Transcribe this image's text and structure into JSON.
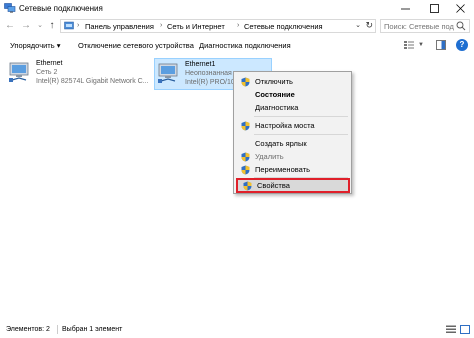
{
  "window": {
    "title": "Сетевые подключения",
    "minimize_icon": "minimize-icon",
    "maximize_icon": "maximize-icon",
    "close_icon": "close-icon"
  },
  "address": {
    "crumbs": [
      "Панель управления",
      "Сеть и Интернет",
      "Сетевые подключения"
    ],
    "search_placeholder": "Поиск: Сетевые подключения"
  },
  "toolbar": {
    "organize": "Упорядочить ▾",
    "disable": "Отключение сетевого устройства",
    "diagnose": "Диагностика подключения",
    "help": "?"
  },
  "connections": [
    {
      "name": "Ethernet",
      "status": "Сеть 2",
      "adapter": "Intel(R) 82574L Gigabit Network C..."
    },
    {
      "name": "Ethernet1",
      "status": "Неопознанная сеть",
      "adapter": "Intel(R) PRO/10"
    }
  ],
  "context_menu": {
    "items": [
      {
        "label": "Отключить",
        "shield": true,
        "bold": false,
        "disabled": false
      },
      {
        "label": "Состояние",
        "shield": false,
        "bold": true,
        "disabled": false
      },
      {
        "label": "Диагностика",
        "shield": false,
        "bold": false,
        "disabled": false
      },
      {
        "label": "Настройка моста",
        "shield": true,
        "bold": false,
        "disabled": false
      },
      {
        "label": "Создать ярлык",
        "shield": false,
        "bold": false,
        "disabled": false
      },
      {
        "label": "Удалить",
        "shield": true,
        "bold": false,
        "disabled": true
      },
      {
        "label": "Переименовать",
        "shield": true,
        "bold": false,
        "disabled": false
      },
      {
        "label": "Свойства",
        "shield": true,
        "bold": false,
        "disabled": false,
        "highlighted": true
      }
    ]
  },
  "status": {
    "items_count": "Элементов: 2",
    "selected": "Выбран 1 элемент"
  },
  "colors": {
    "selection": "#cce8ff",
    "highlight_border": "#e0202a"
  }
}
